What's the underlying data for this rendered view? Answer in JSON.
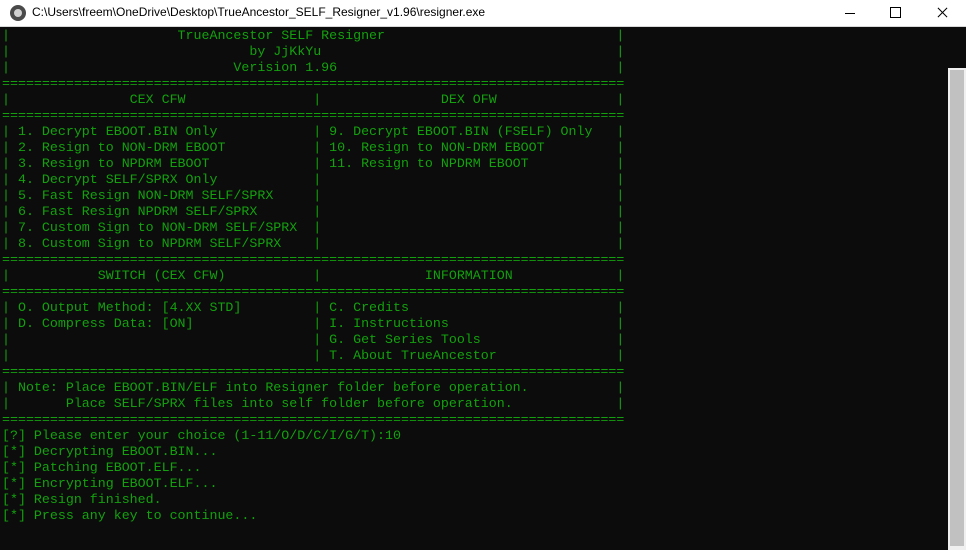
{
  "window": {
    "title": "C:\\Users\\freem\\OneDrive\\Desktop\\TrueAncestor_SELF_Resigner_v1.96\\resigner.exe",
    "buttons": [
      "minimize",
      "maximize",
      "close"
    ]
  },
  "console": {
    "lines": [
      "|                     TrueAncestor SELF Resigner                             |",
      "|                              by JjKkYu                                     |",
      "|                            Verision 1.96                                   |",
      "==============================================================================",
      "|               CEX CFW                |               DEX OFW               |",
      "==============================================================================",
      "| 1. Decrypt EBOOT.BIN Only            | 9. Decrypt EBOOT.BIN (FSELF) Only   |",
      "| 2. Resign to NON-DRM EBOOT           | 10. Resign to NON-DRM EBOOT         |",
      "| 3. Resign to NPDRM EBOOT             | 11. Resign to NPDRM EBOOT           |",
      "| 4. Decrypt SELF/SPRX Only            |                                     |",
      "| 5. Fast Resign NON-DRM SELF/SPRX     |                                     |",
      "| 6. Fast Resign NPDRM SELF/SPRX       |                                     |",
      "| 7. Custom Sign to NON-DRM SELF/SPRX  |                                     |",
      "| 8. Custom Sign to NPDRM SELF/SPRX    |                                     |",
      "==============================================================================",
      "|           SWITCH (CEX CFW)           |             INFORMATION             |",
      "==============================================================================",
      "| O. Output Method: [4.XX STD]         | C. Credits                          |",
      "| D. Compress Data: [ON]               | I. Instructions                     |",
      "|                                      | G. Get Series Tools                 |",
      "|                                      | T. About TrueAncestor               |",
      "==============================================================================",
      "| Note: Place EBOOT.BIN/ELF into Resigner folder before operation.           |",
      "|       Place SELF/SPRX files into self folder before operation.             |",
      "==============================================================================",
      "[?] Please enter your choice (1-11/O/D/C/I/G/T):10",
      "[*] Decrypting EBOOT.BIN...",
      "[*] Patching EBOOT.ELF...",
      "[*] Encrypting EBOOT.ELF...",
      "[*] Resign finished.",
      "[*] Press any key to continue..."
    ]
  },
  "colors": {
    "console_bg": "#0c0c0c",
    "console_text": "#13a10e",
    "titlebar_bg": "#ffffff"
  }
}
